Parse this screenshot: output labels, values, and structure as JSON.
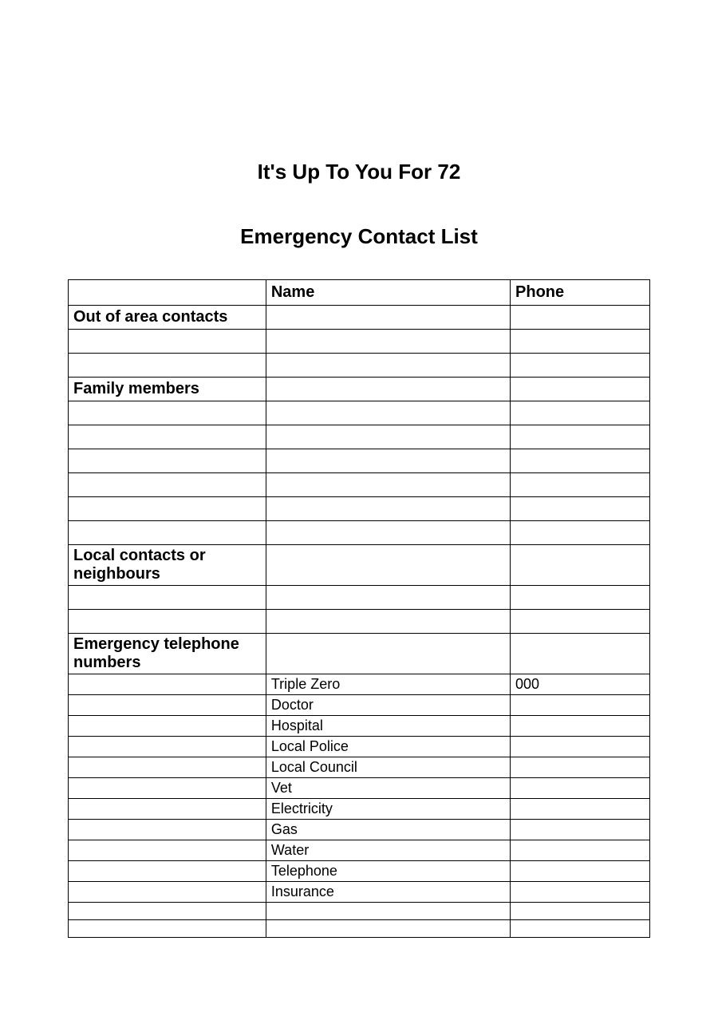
{
  "title_main": "It's Up To You For 72",
  "title_sub": "Emergency Contact List",
  "headers": {
    "category": "",
    "name": "Name",
    "phone": "Phone"
  },
  "sections": {
    "out_of_area": "Out of area contacts",
    "family": "Family members",
    "local": "Local contacts or neighbours",
    "emergency": "Emergency telephone numbers"
  },
  "emergency_rows": [
    {
      "name": "Triple Zero",
      "phone": "000"
    },
    {
      "name": "Doctor",
      "phone": ""
    },
    {
      "name": "Hospital",
      "phone": ""
    },
    {
      "name": "Local Police",
      "phone": ""
    },
    {
      "name": "Local Council",
      "phone": ""
    },
    {
      "name": "Vet",
      "phone": ""
    },
    {
      "name": "Electricity",
      "phone": ""
    },
    {
      "name": "Gas",
      "phone": ""
    },
    {
      "name": "Water",
      "phone": ""
    },
    {
      "name": "Telephone",
      "phone": ""
    },
    {
      "name": "Insurance",
      "phone": ""
    }
  ]
}
